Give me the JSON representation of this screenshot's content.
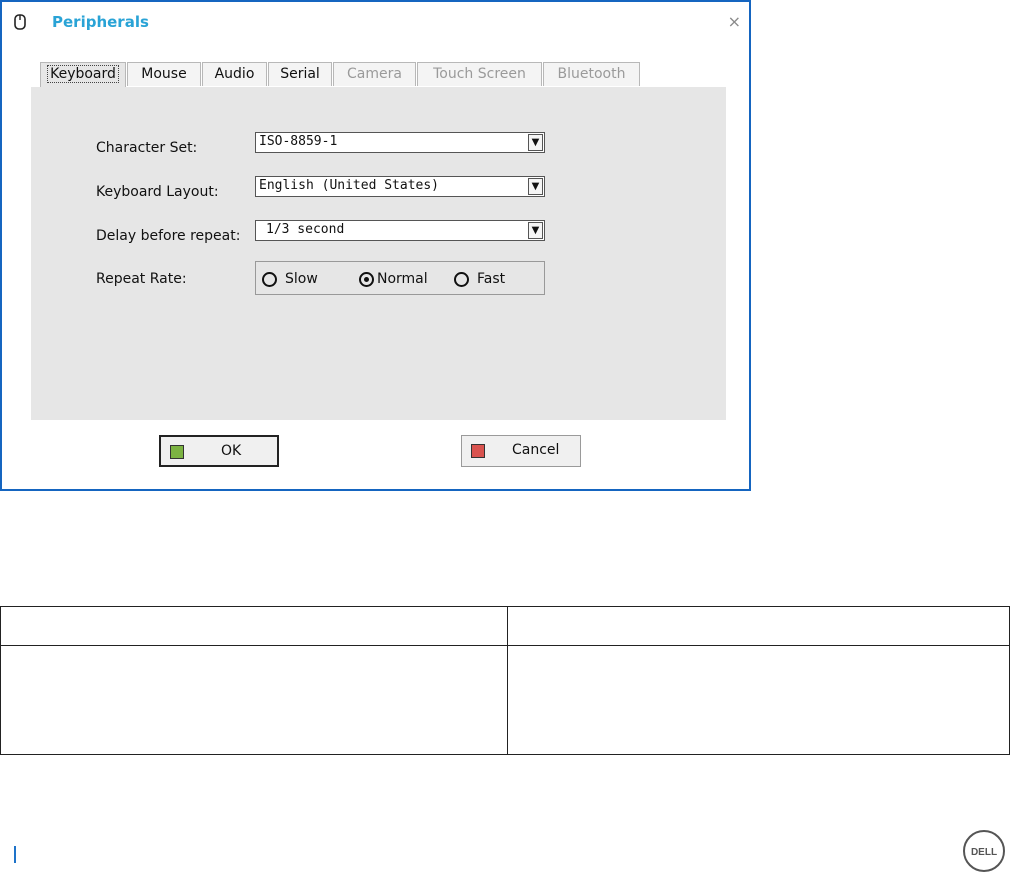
{
  "dialog": {
    "title": "Peripherals",
    "close_glyph": "×",
    "title_icon": "mouse-icon",
    "tabs": [
      {
        "label": "Keyboard",
        "state": "active"
      },
      {
        "label": "Mouse",
        "state": "enabled"
      },
      {
        "label": "Audio",
        "state": "enabled"
      },
      {
        "label": "Serial",
        "state": "enabled"
      },
      {
        "label": "Camera",
        "state": "disabled"
      },
      {
        "label": "Touch Screen",
        "state": "disabled"
      },
      {
        "label": "Bluetooth",
        "state": "disabled"
      }
    ],
    "keyboard": {
      "character_set": {
        "label": "Character Set:",
        "value": "ISO-8859-1"
      },
      "keyboard_layout": {
        "label": "Keyboard Layout:",
        "value": "English (United States)"
      },
      "delay_before_repeat": {
        "label": "Delay before repeat:",
        "value": "1/3 second"
      },
      "repeat_rate": {
        "label": "Repeat Rate:",
        "options": [
          "Slow",
          "Normal",
          "Fast"
        ],
        "selected": "Normal"
      }
    },
    "buttons": {
      "ok": "OK",
      "cancel": "Cancel"
    }
  },
  "table": {
    "header": [
      "",
      ""
    ],
    "rows": [
      [
        "",
        ""
      ]
    ]
  },
  "footer": {
    "logo_text": "DELL",
    "accent_color": "#1e73c9"
  },
  "colors": {
    "title": "#29a3d6",
    "dialog_border": "#1565c0",
    "panel_bg": "#e6e6e6"
  }
}
